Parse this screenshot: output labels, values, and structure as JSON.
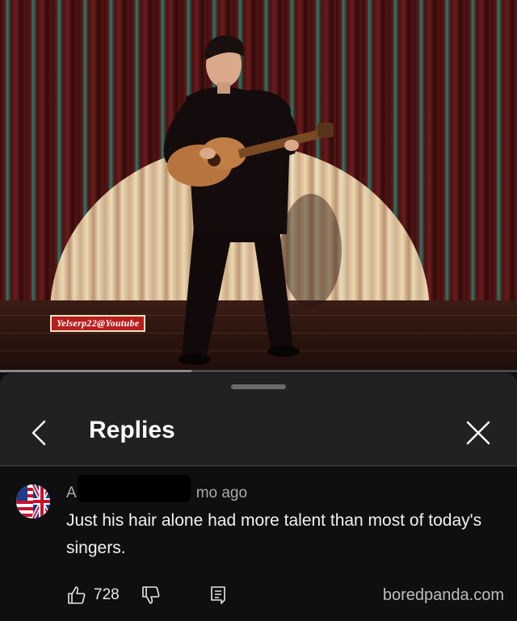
{
  "video": {
    "watermark": "Yelserp22@Youtube",
    "progress_fraction": 0.14,
    "buffered_fraction": 0.37
  },
  "panel": {
    "title": "Replies"
  },
  "comment": {
    "author_prefix": "A",
    "age_suffix": "mo ago",
    "text": "Just his hair alone had more talent than most of today's singers.",
    "like_count": "728"
  },
  "footer": {
    "credit": "boredpanda.com"
  },
  "icons": {
    "back": "chevron-left-icon",
    "close": "close-icon",
    "like": "thumbs-up-icon",
    "dislike": "thumbs-down-icon",
    "reply": "comment-icon",
    "avatar": "uk-flag-avatar"
  },
  "colors": {
    "progress": "#e52d27",
    "background": "#0f0f0f",
    "panel": "#212121"
  }
}
